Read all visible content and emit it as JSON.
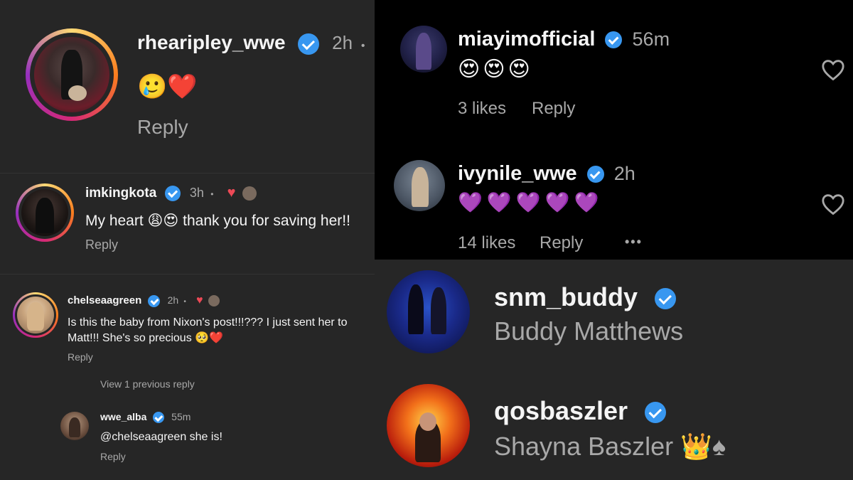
{
  "comment_rhea": {
    "username": "rhearipley_wwe",
    "time": "2h",
    "separator": "•",
    "emojis": "🥲❤️",
    "reply_label": "Reply"
  },
  "reply_kota": {
    "username": "imkingkota",
    "time": "3h",
    "separator": "•",
    "text": "My heart 😩😍 thank you for saving her!!",
    "reply_label": "Reply"
  },
  "reply_chelsea": {
    "username": "chelseaagreen",
    "time": "2h",
    "separator": "•",
    "text_line1": "Is this the baby from Nixon's post!!!??? I just sent her to",
    "text_line2": "Matt!!! She's so precious 🥺❤️",
    "reply_label": "Reply",
    "view_previous": "View 1 previous reply"
  },
  "reply_alba": {
    "username": "wwe_alba",
    "time": "55m",
    "text": "@chelseaagreen she is!",
    "reply_label": "Reply"
  },
  "comment_miayim": {
    "username": "miayimofficial",
    "time": "56m",
    "emojis": "😍😍😍",
    "likes": "3 likes",
    "reply_label": "Reply"
  },
  "comment_ivy": {
    "username": "ivynile_wwe",
    "time": "2h",
    "emojis": "💜💜💜💜💜",
    "likes": "14 likes",
    "reply_label": "Reply",
    "more": "•••"
  },
  "profile_buddy": {
    "username": "snm_buddy",
    "full_name": "Buddy Matthews"
  },
  "profile_shayna": {
    "username": "qosbaszler",
    "full_name": "Shayna Baszler 👑♠"
  },
  "colors": {
    "verified_blue": "#3897f0",
    "panel_dark": "#262626",
    "panel_black": "#000000",
    "muted_text": "#a8a8a8"
  }
}
